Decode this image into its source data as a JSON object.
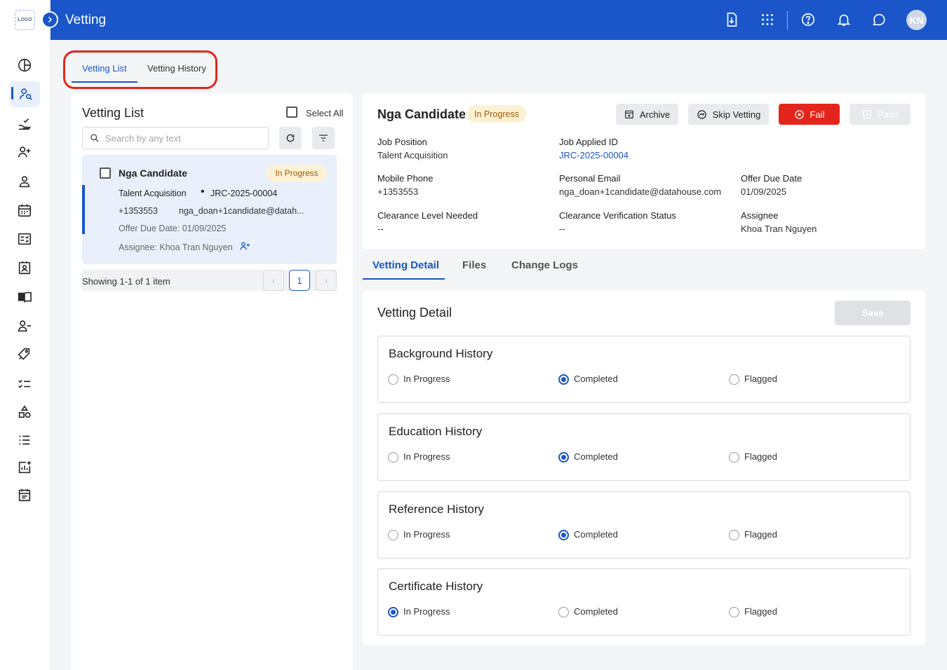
{
  "app": {
    "logo_text": "LOGO",
    "title": "Vetting",
    "avatar_initials": "KN",
    "accent": "#1a56c9"
  },
  "page_tabs": [
    {
      "label": "Vetting List",
      "active": true
    },
    {
      "label": "Vetting History",
      "active": false
    }
  ],
  "list": {
    "title": "Vetting List",
    "select_all": "Select All",
    "search_placeholder": "Search by any text",
    "items": [
      {
        "name": "Nga Candidate",
        "status": "In Progress",
        "position": "Talent Acquisition",
        "job_id": "JRC-2025-00004",
        "phone": "+1353553",
        "email": "nga_doan+1candidate@datah...",
        "offer_due": "Offer Due Date: 01/09/2025",
        "assignee": "Assignee: Khoa Tran Nguyen"
      }
    ],
    "showing": "Showing 1-1 of 1 item",
    "page": "1"
  },
  "candidate": {
    "name": "Nga Candidate",
    "status": "In Progress",
    "actions": {
      "archive": "Archive",
      "skip": "Skip Vetting",
      "fail": "Fail",
      "pass": "Pass"
    },
    "fields": {
      "job_position_label": "Job Position",
      "job_position": "Talent Acquisition",
      "job_applied_id_label": "Job Applied ID",
      "job_applied_id": "JRC-2025-00004",
      "mobile_label": "Mobile Phone",
      "mobile": "+1353553",
      "email_label": "Personal Email",
      "email": "nga_doan+1candidate@datahouse.com",
      "offer_due_label": "Offer Due Date",
      "offer_due": "01/09/2025",
      "clearance_label": "Clearance Level Needed",
      "clearance": "--",
      "verification_label": "Clearance Verification Status",
      "verification": "--",
      "assignee_label": "Assignee",
      "assignee": "Khoa Tran Nguyen"
    }
  },
  "detail_tabs": [
    {
      "label": "Vetting Detail",
      "active": true
    },
    {
      "label": "Files"
    },
    {
      "label": "Change Logs"
    }
  ],
  "detail": {
    "title": "Vetting Detail",
    "save": "Save",
    "options": [
      "In Progress",
      "Completed",
      "Flagged"
    ],
    "sections": [
      {
        "title": "Background History",
        "selected": "Completed"
      },
      {
        "title": "Education History",
        "selected": "Completed"
      },
      {
        "title": "Reference History",
        "selected": "Completed"
      },
      {
        "title": "Certificate History",
        "selected": "In Progress"
      }
    ]
  }
}
